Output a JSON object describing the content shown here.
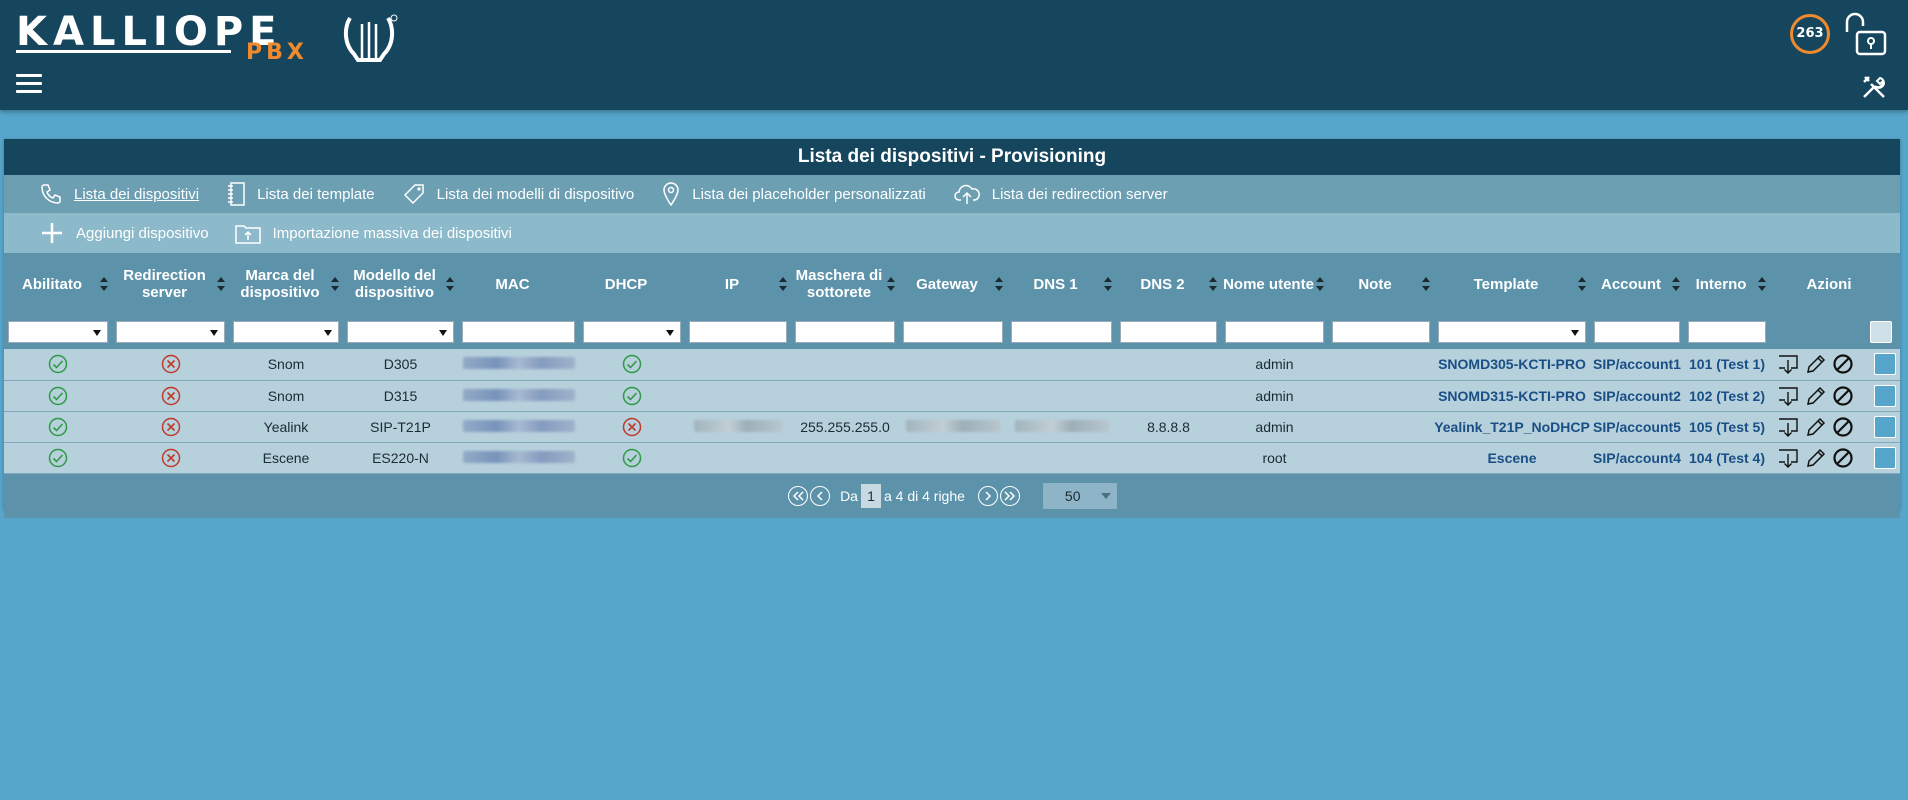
{
  "header": {
    "logo_text": "KALLIOPE",
    "logo_sub": "PBX",
    "counter": "263"
  },
  "panel": {
    "title": "Lista dei dispositivi - Provisioning",
    "nav": [
      {
        "label": "Lista dei dispositivi",
        "icon": "phone-icon",
        "active": true
      },
      {
        "label": "Lista dei template",
        "icon": "notebook-icon"
      },
      {
        "label": "Lista dei modelli di dispositivo",
        "icon": "tag-icon"
      },
      {
        "label": "Lista dei placeholder personalizzati",
        "icon": "map-pin-icon"
      },
      {
        "label": "Lista dei redirection server",
        "icon": "cloud-upload-icon"
      }
    ],
    "actions": [
      {
        "label": "Aggiungi dispositivo",
        "icon": "plus-icon"
      },
      {
        "label": "Importazione massiva dei dispositivi",
        "icon": "folder-upload-icon"
      }
    ]
  },
  "table": {
    "columns": [
      "Abilitato",
      "Redirection server",
      "Marca del dispositivo",
      "Modello del dispositivo",
      "MAC",
      "DHCP",
      "IP",
      "Maschera di sottorete",
      "Gateway",
      "DNS 1",
      "DNS 2",
      "Nome utente",
      "Note",
      "Template",
      "Account",
      "Interno",
      "Azioni"
    ],
    "rows": [
      {
        "enabled": true,
        "redirection": false,
        "brand": "Snom",
        "model": "D305",
        "dhcp": true,
        "ip": "",
        "mask": "",
        "gateway": "",
        "dns1": "",
        "dns2": "",
        "user": "admin",
        "note": "",
        "template": "SNOMD305-KCTI-PRO",
        "account": "SIP/account1",
        "ext": "101 (Test 1)"
      },
      {
        "enabled": true,
        "redirection": false,
        "brand": "Snom",
        "model": "D315",
        "dhcp": true,
        "ip": "",
        "mask": "",
        "gateway": "",
        "dns1": "",
        "dns2": "",
        "user": "admin",
        "note": "",
        "template": "SNOMD315-KCTI-PRO",
        "account": "SIP/account2",
        "ext": "102 (Test 2)"
      },
      {
        "enabled": true,
        "redirection": false,
        "brand": "Yealink",
        "model": "SIP-T21P",
        "dhcp": false,
        "ip": "",
        "mask": "255.255.255.0",
        "gateway": "",
        "dns1": "",
        "dns2": "8.8.8.8",
        "user": "admin",
        "note": "",
        "template": "Yealink_T21P_NoDHCP",
        "account": "SIP/account5",
        "ext": "105 (Test 5)"
      },
      {
        "enabled": true,
        "redirection": false,
        "brand": "Escene",
        "model": "ES220-N",
        "dhcp": true,
        "ip": "",
        "mask": "",
        "gateway": "",
        "dns1": "",
        "dns2": "",
        "user": "root",
        "note": "",
        "template": "Escene",
        "account": "SIP/account4",
        "ext": "104 (Test 4)"
      }
    ]
  },
  "pager": {
    "from_label": "Da",
    "page": "1",
    "range_label": "a 4 di 4 righe",
    "page_size": "50"
  },
  "colors": {
    "header_bg": "#16465e",
    "page_bg": "#56a5cb",
    "accent": "#f08a2c",
    "link": "#1a4f86",
    "ok": "#2f9a45",
    "ko": "#c0392b"
  }
}
